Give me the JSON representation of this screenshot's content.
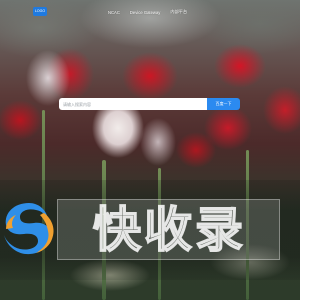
{
  "header": {
    "logo_label": "LOGO",
    "nav": [
      {
        "label": "NCAC"
      },
      {
        "label": "Device Gateway"
      },
      {
        "label": "内部平台"
      }
    ]
  },
  "search": {
    "placeholder": "请输入搜索内容",
    "button_label": "百度一下"
  },
  "watermark": {
    "text": "快收录",
    "logo_colors": [
      "#2f8fe8",
      "#f0a030"
    ]
  },
  "colors": {
    "accent": "#2b8af0"
  }
}
